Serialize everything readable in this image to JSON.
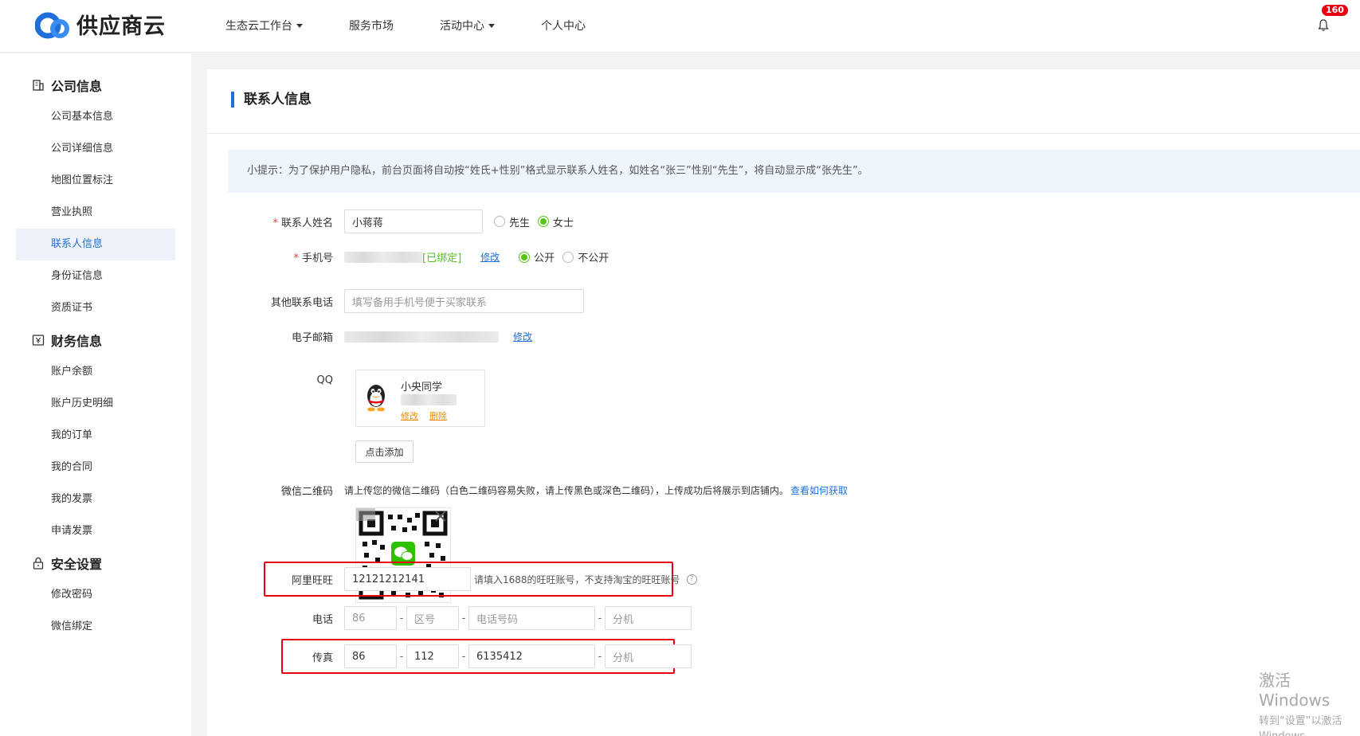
{
  "header": {
    "brand": "供应商云",
    "nav": [
      {
        "label": "生态云工作台",
        "dropdown": true
      },
      {
        "label": "服务市场",
        "dropdown": false
      },
      {
        "label": "活动中心",
        "dropdown": true
      },
      {
        "label": "个人中心",
        "dropdown": false
      }
    ],
    "notification_count": "160"
  },
  "sidebar": {
    "groups": [
      {
        "title": "公司信息",
        "icon": "building-icon",
        "items": [
          "公司基本信息",
          "公司详细信息",
          "地图位置标注",
          "营业执照",
          "联系人信息",
          "身份证信息",
          "资质证书"
        ]
      },
      {
        "title": "财务信息",
        "icon": "finance-icon",
        "items": [
          "账户余额",
          "账户历史明细",
          "我的订单",
          "我的合同",
          "我的发票",
          "申请发票"
        ]
      },
      {
        "title": "安全设置",
        "icon": "lock-icon",
        "items": [
          "修改密码",
          "微信绑定"
        ]
      }
    ],
    "active_item": "联系人信息"
  },
  "main": {
    "title": "联系人信息",
    "tip": "小提示：为了保护用户隐私，前台页面将自动按“姓氏+性别”格式显示联系人姓名，如姓名“张三”性别“先生”，将自动显示成“张先生”。",
    "name": {
      "label": "联系人姓名",
      "value": "小蒋蒋",
      "options": [
        "先生",
        "女士"
      ],
      "selected": "女士"
    },
    "mobile": {
      "label": "手机号",
      "bound_text": "[已绑定]",
      "edit": "修改",
      "options": [
        "公开",
        "不公开"
      ],
      "selected": "公开"
    },
    "other_phone": {
      "label": "其他联系电话",
      "placeholder": "填写备用手机号便于买家联系"
    },
    "email": {
      "label": "电子邮箱",
      "edit": "修改"
    },
    "qq": {
      "label": "QQ",
      "nickname": "小央同学",
      "edit": "修改",
      "delete": "删除",
      "add_button": "点击添加"
    },
    "wechat": {
      "label": "微信二维码",
      "hint": "请上传您的微信二维码（白色二维码容易失败，请上传黑色或深色二维码），上传成功后将展示到店铺内。",
      "link": "查看如何获取"
    },
    "aliwangwang": {
      "label": "阿里旺旺",
      "value": "12121212141",
      "hint": "请填入1688的旺旺账号，不支持淘宝的旺旺账号"
    },
    "tel": {
      "label": "电话",
      "country_placeholder": "86",
      "area_placeholder": "区号",
      "number_placeholder": "电话号码",
      "ext_placeholder": "分机"
    },
    "fax": {
      "label": "传真",
      "country": "86",
      "area": "112",
      "number": "6135412",
      "ext_placeholder": "分机"
    }
  },
  "watermark": {
    "line1": "激活 Windows",
    "line2": "转到“设置”以激活 Windows。"
  },
  "colors": {
    "accent": "#1e6fd9",
    "success": "#52c41a",
    "alert": "#e60012"
  }
}
